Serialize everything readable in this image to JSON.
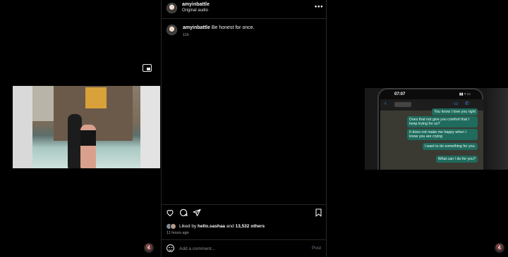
{
  "post": {
    "username": "amyinbattle",
    "audio_label": "Original audio",
    "more_label": "•••",
    "caption": {
      "username": "amyinbattle",
      "text": "Be honest for once.",
      "time": "11h"
    },
    "likes": {
      "prefix": "Liked by ",
      "user": "hello.sashaa",
      "middle": " and ",
      "count": "13,532 others"
    },
    "time_ago": "11 hours ago",
    "comment": {
      "placeholder": "Add a comment...",
      "post_label": "Post"
    }
  },
  "right_video": {
    "phone_time": "07:07",
    "phone_status": "▮▮ ≈ ▭",
    "back_icon": "‹",
    "video_icon": "▭",
    "call_icon": "✆",
    "messages": [
      "You know I love you right",
      "Does that not give you comfort that I keep trying for us?",
      "It does not make me happy when I know you are crying",
      "I want to do something for you.",
      "What can I do for you?"
    ]
  },
  "icons": {
    "pip": "picture-in-picture-icon",
    "mute": "🔇",
    "like": "heart-icon",
    "comment": "comment-icon",
    "share": "share-icon",
    "save": "bookmark-icon",
    "emoji": "emoji-icon"
  },
  "colors": {
    "background": "#000000",
    "divider": "#262626",
    "muted_text": "#a8a8a8",
    "post_button": "#6f7f92",
    "chat_bubble": "#1f6b5d"
  }
}
